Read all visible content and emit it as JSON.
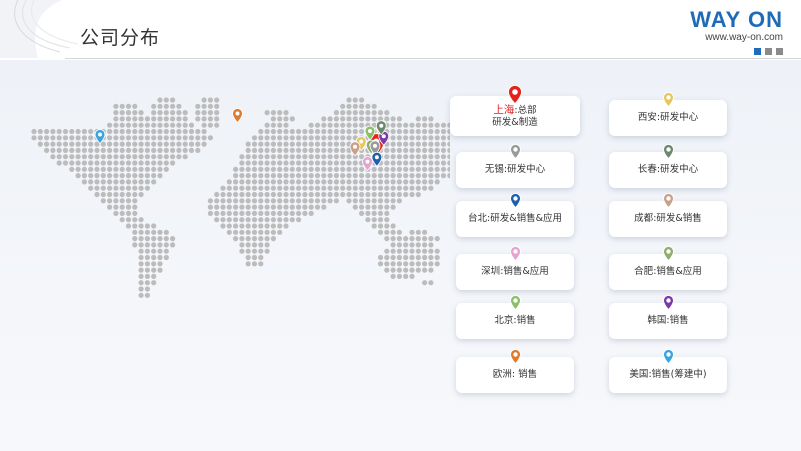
{
  "header": {
    "title": "公司分布",
    "logo_text": "WAY ON",
    "logo_url": "www.way-on.com",
    "logo_color": "#1e6bb8"
  },
  "locations": [
    {
      "id": "shanghai",
      "name": "上海",
      "sep": ":",
      "role": "总部",
      "role2": "研发&制造",
      "color": "#e3241b"
    },
    {
      "id": "xian",
      "name": "西安",
      "sep": ":",
      "role": "研发中心",
      "color": "#e8c65a"
    },
    {
      "id": "wuxi",
      "name": "无锡",
      "sep": ":",
      "role": "研发中心",
      "color": "#9a9a9a"
    },
    {
      "id": "changchun",
      "name": "长春",
      "sep": ":",
      "role": "研发中心",
      "color": "#6b8a6b"
    },
    {
      "id": "taipei",
      "name": "台北",
      "sep": ":",
      "role": "研发&销售&应用",
      "color": "#1f5fb0"
    },
    {
      "id": "chengdu",
      "name": "成都",
      "sep": ":",
      "role": "研发&销售",
      "color": "#c9a08a"
    },
    {
      "id": "shenzhen",
      "name": "深圳",
      "sep": ":",
      "role": "销售&应用",
      "color": "#e7a2d0"
    },
    {
      "id": "hefei",
      "name": "合肥",
      "sep": ":",
      "role": "销售&应用",
      "color": "#8fae6e"
    },
    {
      "id": "beijing",
      "name": "北京",
      "sep": ":",
      "role": "销售",
      "color": "#8cbf6a"
    },
    {
      "id": "korea",
      "name": "韩国",
      "sep": ":",
      "role": "销售",
      "color": "#7b3aa6"
    },
    {
      "id": "europe",
      "name": "欧洲",
      "sep": ":",
      "role": " 销售",
      "color": "#e07b2d"
    },
    {
      "id": "usa",
      "name": "美国",
      "sep": ":",
      "role": "销售(筹建中)",
      "color": "#3aa3e0"
    }
  ],
  "map_pins": [
    {
      "loc": "usa",
      "lon": -100,
      "lat": 38
    },
    {
      "loc": "europe",
      "lon": 10,
      "lat": 50
    },
    {
      "loc": "shanghai",
      "lon": 121,
      "lat": 31
    },
    {
      "loc": "korea",
      "lon": 127,
      "lat": 37
    },
    {
      "loc": "changchun",
      "lon": 125,
      "lat": 43
    },
    {
      "loc": "beijing",
      "lon": 116,
      "lat": 40
    },
    {
      "loc": "xian",
      "lon": 109,
      "lat": 34
    },
    {
      "loc": "chengdu",
      "lon": 104,
      "lat": 31
    },
    {
      "loc": "hefei",
      "lon": 117,
      "lat": 32
    },
    {
      "loc": "wuxi",
      "lon": 120,
      "lat": 31.5
    },
    {
      "loc": "shenzhen",
      "lon": 114,
      "lat": 22.5
    },
    {
      "loc": "taipei",
      "lon": 121.5,
      "lat": 25
    }
  ]
}
